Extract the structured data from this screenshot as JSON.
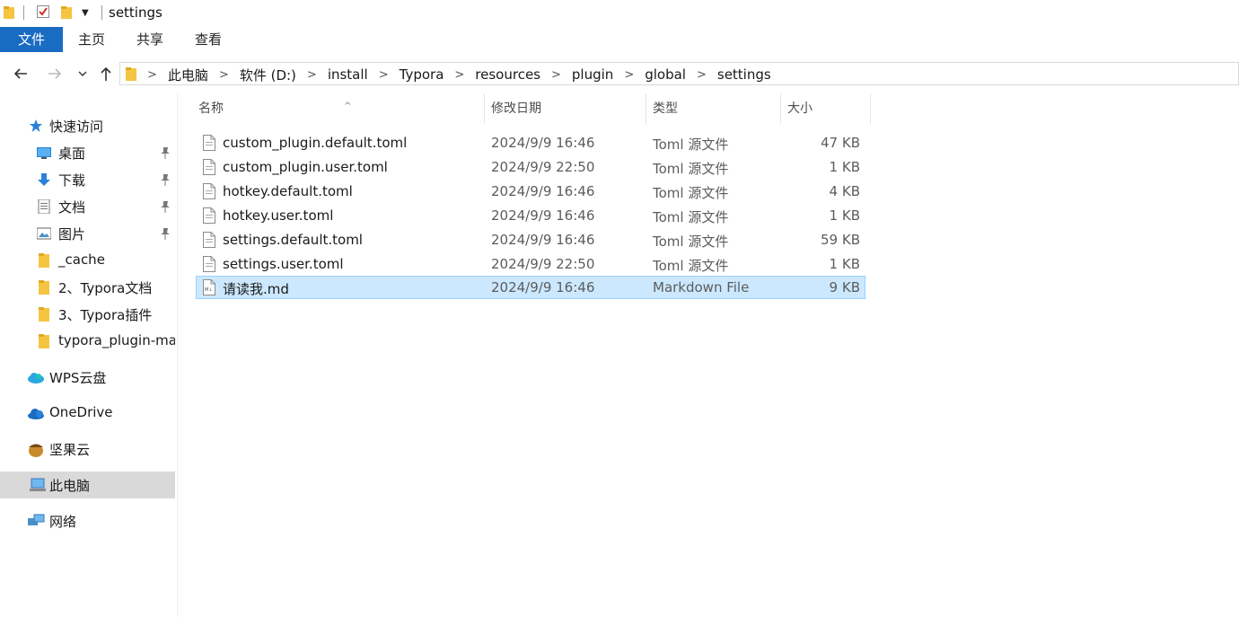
{
  "window": {
    "title": "settings"
  },
  "ribbon": {
    "tabs": [
      "文件",
      "主页",
      "共享",
      "查看"
    ]
  },
  "breadcrumb": [
    "此电脑",
    "软件 (D:)",
    "install",
    "Typora",
    "resources",
    "plugin",
    "global",
    "settings"
  ],
  "sidebar": {
    "items": [
      {
        "label": "快速访问",
        "icon": "star-icon",
        "pinned": false
      },
      {
        "label": "桌面",
        "icon": "desktop-icon",
        "pinned": true
      },
      {
        "label": "下载",
        "icon": "download-icon",
        "pinned": true
      },
      {
        "label": "文档",
        "icon": "document-icon",
        "pinned": true
      },
      {
        "label": "图片",
        "icon": "picture-icon",
        "pinned": true
      },
      {
        "label": "_cache",
        "icon": "folder-icon",
        "pinned": false
      },
      {
        "label": "2、Typora文档",
        "icon": "folder-icon",
        "pinned": false
      },
      {
        "label": "3、Typora插件",
        "icon": "folder-icon",
        "pinned": false
      },
      {
        "label": "typora_plugin-ma",
        "icon": "folder-icon",
        "pinned": false
      },
      {
        "label": "WPS云盘",
        "icon": "wps-cloud-icon",
        "pinned": false
      },
      {
        "label": "OneDrive",
        "icon": "onedrive-icon",
        "pinned": false
      },
      {
        "label": "坚果云",
        "icon": "nutstore-icon",
        "pinned": false
      },
      {
        "label": "此电脑",
        "icon": "this-pc-icon",
        "pinned": false,
        "selected": true
      },
      {
        "label": "网络",
        "icon": "network-icon",
        "pinned": false
      }
    ]
  },
  "columns": {
    "name": "名称",
    "date": "修改日期",
    "type": "类型",
    "size": "大小"
  },
  "files": [
    {
      "name": "custom_plugin.default.toml",
      "date": "2024/9/9 16:46",
      "type": "Toml 源文件",
      "size": "47 KB"
    },
    {
      "name": "custom_plugin.user.toml",
      "date": "2024/9/9 22:50",
      "type": "Toml 源文件",
      "size": "1 KB"
    },
    {
      "name": "hotkey.default.toml",
      "date": "2024/9/9 16:46",
      "type": "Toml 源文件",
      "size": "4 KB"
    },
    {
      "name": "hotkey.user.toml",
      "date": "2024/9/9 16:46",
      "type": "Toml 源文件",
      "size": "1 KB"
    },
    {
      "name": "settings.default.toml",
      "date": "2024/9/9 16:46",
      "type": "Toml 源文件",
      "size": "59 KB"
    },
    {
      "name": "settings.user.toml",
      "date": "2024/9/9 22:50",
      "type": "Toml 源文件",
      "size": "1 KB"
    },
    {
      "name": "请读我.md",
      "date": "2024/9/9 16:46",
      "type": "Markdown File",
      "size": "9 KB",
      "selected": true
    }
  ],
  "colors": {
    "accent": "#1a6cc2",
    "selection": "#cce8ff",
    "selection_border": "#99d1ff",
    "folder": "#f5c542"
  }
}
